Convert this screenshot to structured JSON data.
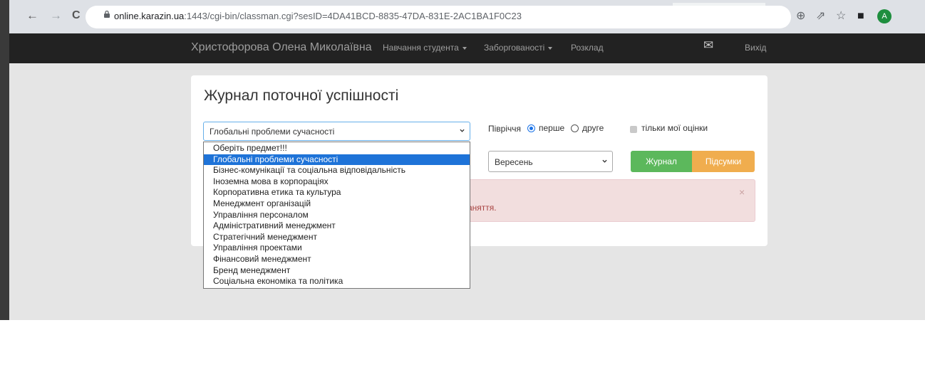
{
  "browser": {
    "url_host": "online.karazin.ua",
    "url_path": ":1443/cgi-bin/classman.cgi?sesID=4DA41BCD-8835-47DA-831E-2AC1BA1F0C23",
    "back_icon": "←",
    "forward_icon": "→",
    "reload_icon": "C",
    "zoom_icon": "⊕",
    "share_icon": "⇗",
    "star_icon": "☆",
    "sidepanel_icon": "■",
    "profile_initial": "A"
  },
  "navbar": {
    "user_name": "Христофорова Олена Миколаївна",
    "items": [
      "Навчання студента",
      "Заборгованості",
      "Розклад"
    ],
    "mail_icon": "✉",
    "logout": "Вихід"
  },
  "page": {
    "title": "Журнал поточної успішності",
    "subject_select_value": "Глобальні проблеми сучасності",
    "half_year_label": "Півріччя",
    "half_year_options": [
      "перше",
      "друге"
    ],
    "half_year_selected": "перше",
    "only_mine_label": "тільки мої оцінки",
    "month_select_value": "Вересень",
    "journal_button": "Журнал",
    "totals_button": "Підсумки",
    "alert_text": "аняття.",
    "alert_close": "×"
  },
  "dropdown": {
    "selected_index": 1,
    "options": [
      "Оберіть предмет!!!",
      "Глобальні проблеми сучасності",
      "Бізнес-комунікації та соціальна відповідальність",
      "Іноземна мова в корпораціях",
      "Корпоративна етика та культура",
      "Менеджмент організацій",
      "Управління персоналом",
      "Адміністративний менеджмент",
      "Стратегічний менеджмент",
      "Управління проектами",
      "Фінансовий менеджмент",
      "Бренд менеджмент",
      "Соціальна економіка та політика"
    ]
  },
  "colors": {
    "navbar_bg": "#222222",
    "journal_btn": "#5cb85c",
    "totals_btn": "#f0ad4e",
    "selection": "#1e73d8",
    "alert_bg": "#f2dede"
  }
}
